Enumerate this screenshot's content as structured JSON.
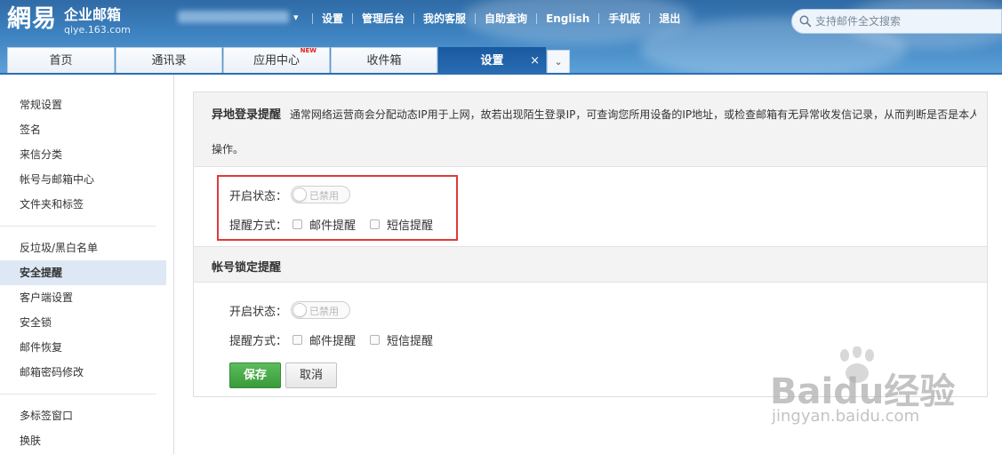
{
  "header": {
    "logo_mark": "網易",
    "logo_title": "企业邮箱",
    "logo_domain": "qiye.163.com",
    "nav": [
      "设置",
      "管理后台",
      "我的客服",
      "自助查询",
      "English",
      "手机版",
      "退出"
    ],
    "search_placeholder": "支持邮件全文搜索"
  },
  "tabs": {
    "items": [
      {
        "label": "首页"
      },
      {
        "label": "通讯录"
      },
      {
        "label": "应用中心",
        "badge": "NEW"
      },
      {
        "label": "收件箱"
      },
      {
        "label": "设置",
        "close": "×"
      }
    ],
    "more": "⌄"
  },
  "sidebar": {
    "group1": [
      "常规设置",
      "签名",
      "来信分类",
      "帐号与邮箱中心",
      "文件夹和标签"
    ],
    "group2": [
      "反垃圾/黑白名单",
      "安全提醒",
      "客户端设置",
      "安全锁",
      "邮件恢复",
      "邮箱密码修改"
    ],
    "group3": [
      "多标签窗口",
      "换肤"
    ],
    "active": "安全提醒"
  },
  "main": {
    "section1": {
      "title": "异地登录提醒",
      "desc_line1": "通常网络运营商会分配动态IP用于上网，故若出现陌生登录IP，可查询您所用设备的IP地址，或检查邮箱有无异常收发信记录，从而判断是否是本人",
      "desc_line2": "操作。",
      "status_label": "开启状态：",
      "toggle_text": "已禁用",
      "remind_label": "提醒方式：",
      "opt_mail": "邮件提醒",
      "opt_sms": "短信提醒"
    },
    "section2": {
      "title": "帐号锁定提醒",
      "status_label": "开启状态：",
      "toggle_text": "已禁用",
      "remind_label": "提醒方式：",
      "opt_mail": "邮件提醒",
      "opt_sms": "短信提醒"
    },
    "save_label": "保存",
    "cancel_label": "取消"
  },
  "watermark": {
    "big": "Baidu经验",
    "small": "jingyan.baidu.com"
  },
  "colors": {
    "header_blue": "#3d82c0",
    "active_tab": "#1a5aa0",
    "save_green": "#3a9a3a",
    "highlight_red": "#e03a3a"
  }
}
